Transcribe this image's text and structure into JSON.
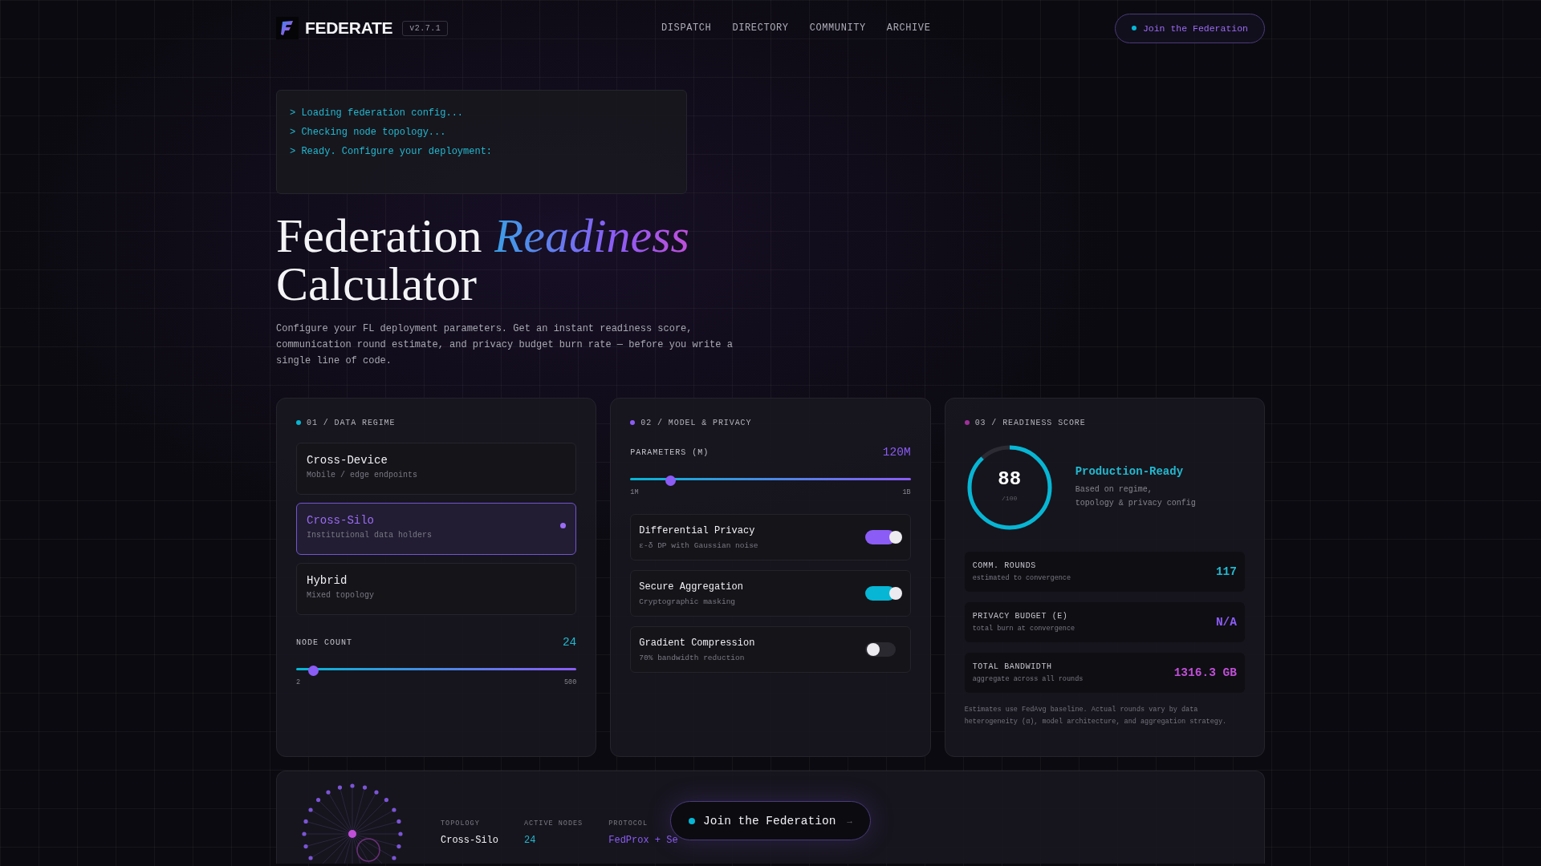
{
  "brand": {
    "name": "FEDERATE",
    "version": "v2.7.1"
  },
  "nav": [
    "DISPATCH",
    "DIRECTORY",
    "COMMUNITY",
    "ARCHIVE"
  ],
  "header_cta": "Join the Federation",
  "terminal": [
    "> Loading federation config...",
    "> Checking node topology...",
    "> Ready. Configure your deployment:"
  ],
  "hero": {
    "title_start": "Federation",
    "title_accent": "Readiness",
    "title_end": "Calculator",
    "description": "Configure your FL deployment parameters. Get an instant readiness score, communication round estimate, and privacy budget burn rate — before you write a single line of code."
  },
  "regime": {
    "heading": "01 / DATA REGIME",
    "options": [
      {
        "title": "Cross-Device",
        "subtitle": "Mobile / edge endpoints",
        "selected": false
      },
      {
        "title": "Cross-Silo",
        "subtitle": "Institutional data holders",
        "selected": true
      },
      {
        "title": "Hybrid",
        "subtitle": "Mixed topology",
        "selected": false
      }
    ],
    "node_count": {
      "label": "NODE COUNT",
      "value": "24",
      "level": 0.05,
      "min": "2",
      "max": "500"
    }
  },
  "model": {
    "heading": "02 / MODEL & PRIVACY",
    "parameters": {
      "label": "PARAMETERS (M)",
      "value": "120M",
      "level": 0.13,
      "min": "1M",
      "max": "1B"
    },
    "toggles": [
      {
        "title": "Differential Privacy",
        "subtitle": "ε-δ DP with Gaussian noise",
        "on": true,
        "color": "#8b5cf6"
      },
      {
        "title": "Secure Aggregation",
        "subtitle": "Cryptographic masking",
        "on": true,
        "color": "#06b6d4"
      },
      {
        "title": "Gradient Compression",
        "subtitle": "70% bandwidth reduction",
        "on": false
      }
    ]
  },
  "score": {
    "heading": "03 / READINESS SCORE",
    "value": "88",
    "scale": "/100",
    "level": 0.88,
    "verdict": "Production-Ready",
    "note_lines": [
      "Based on regime,",
      "topology & privacy config"
    ],
    "metrics": [
      {
        "label": "COMM. ROUNDS",
        "sub": "estimated to convergence",
        "value": "117",
        "color": "#22b8cf"
      },
      {
        "label": "PRIVACY BUDGET (E)",
        "sub": "total burn at convergence",
        "value": "N/A",
        "color": "#8b5cf6"
      },
      {
        "label": "TOTAL BANDWIDTH",
        "sub": "aggregate across all rounds",
        "value": "1316.3 GB",
        "color": "#c04fd8"
      }
    ],
    "footnote": "Estimates use FedAvg baseline. Actual rounds vary by data heterogeneity (α), model architecture, and aggregation strategy."
  },
  "topology": {
    "stats": [
      {
        "label": "TOPOLOGY",
        "value": "Cross-Silo",
        "color": "#f2f2f5"
      },
      {
        "label": "ACTIVE NODES",
        "value": "24",
        "color": "#22b8cf"
      },
      {
        "label": "PROTOCOL",
        "value": "FedProx + Se",
        "color": "#8b5cf6"
      }
    ],
    "cta": {
      "label": "Join the Federation",
      "arrow": "→"
    }
  }
}
